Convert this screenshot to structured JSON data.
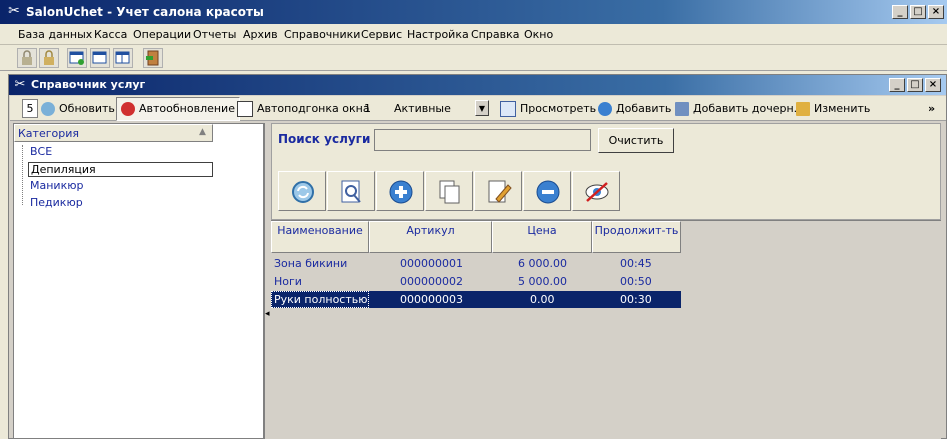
{
  "app": {
    "title": "SalonUchet - Учет салона красоты",
    "window_buttons": [
      "_",
      "□",
      "×"
    ]
  },
  "menu": [
    "База данных",
    "Касса",
    "Операции",
    "Отчеты",
    "Архив",
    "Справочники",
    "Сервис",
    "Настройка",
    "Справка",
    "Окно"
  ],
  "child_window": {
    "title": "Справочник услуг",
    "window_buttons": [
      "_",
      "□",
      "×"
    ]
  },
  "toolbar": {
    "counter": "5",
    "refresh_label": "Обновить",
    "autorefresh_label": "Автообновление",
    "autofit_label": "Автоподгонка окна",
    "autofit_value": "1",
    "filter_value": "Активные",
    "view_label": "Просмотреть",
    "add_label": "Добавить",
    "add_child_label": "Добавить дочерн.",
    "edit_label": "Изменить",
    "more": "»"
  },
  "categories": {
    "header": "Категория",
    "items": [
      "ВСЕ",
      "Депиляция",
      "Маникюр",
      "Педикюр"
    ],
    "selected": "Депиляция"
  },
  "search": {
    "label": "Поиск услуги",
    "value": "",
    "clear_label": "Очистить"
  },
  "grid": {
    "columns": [
      "Наименование",
      "Артикул",
      "Цена",
      "Продолжит-ть"
    ],
    "rows": [
      [
        "Зона бикини",
        "000000001",
        "6 000.00",
        "00:45"
      ],
      [
        "Ноги",
        "000000002",
        "5 000.00",
        "00:50"
      ],
      [
        "Руки полностью",
        "000000003",
        "0.00",
        "00:30"
      ]
    ],
    "selected_row": 2
  },
  "colors": {
    "title_gradient_start": "#0a246a",
    "selection": "#0a246a",
    "label_blue": "#1a2aa0"
  }
}
